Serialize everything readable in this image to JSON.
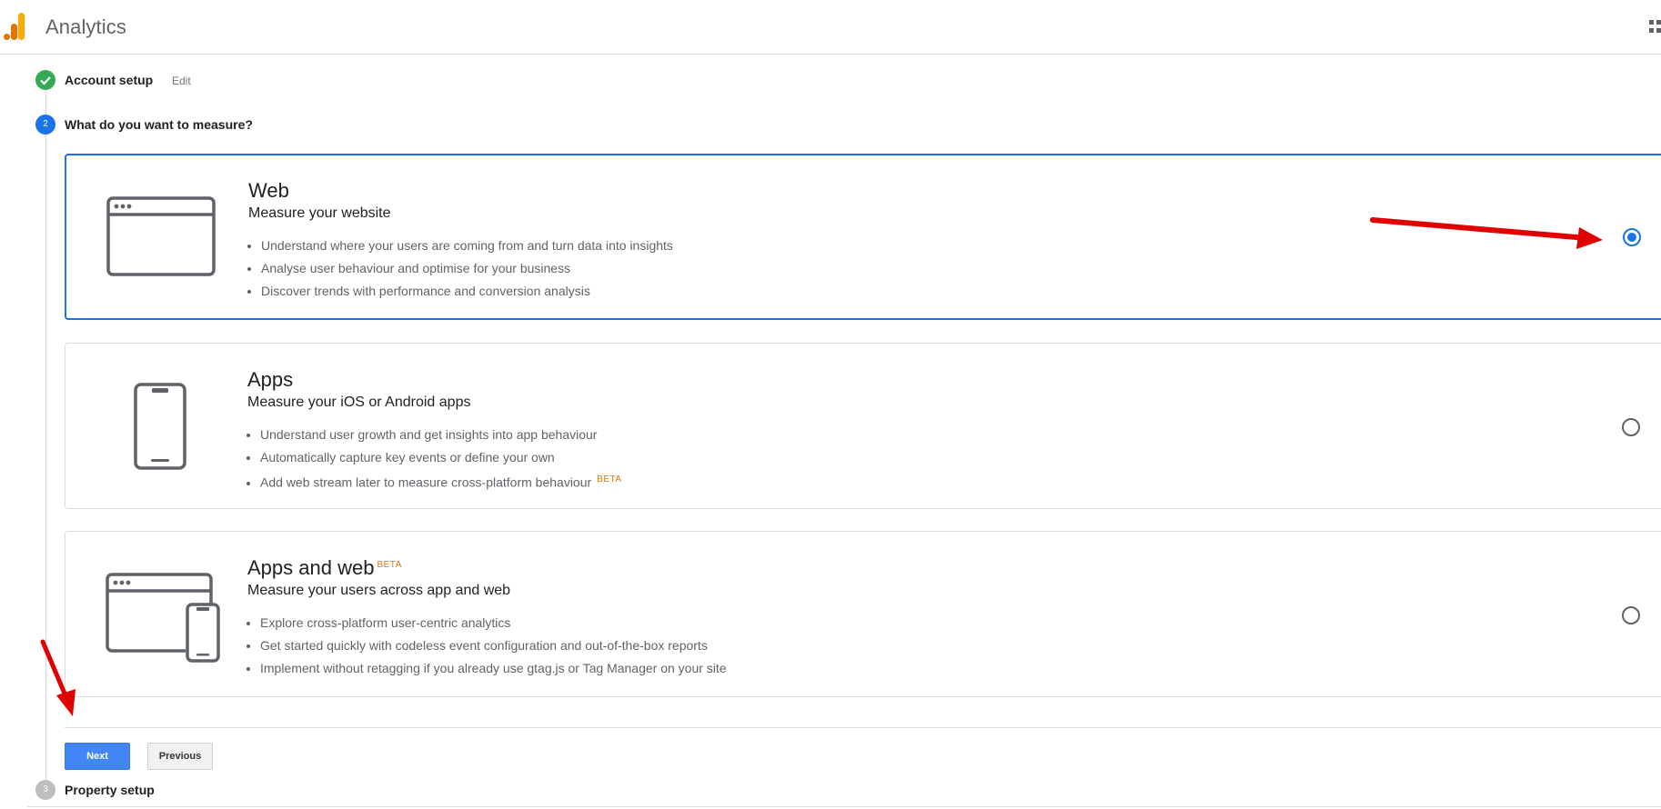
{
  "header": {
    "app_title": "Analytics",
    "logo_icon": "analytics-bar-logo",
    "apps_icon": "apps-grid-icon"
  },
  "steps": {
    "account_setup": {
      "number": "",
      "label": "Account setup",
      "edit_label": "Edit",
      "status": "complete"
    },
    "measure": {
      "number": "2",
      "label": "What do you want to measure?",
      "status": "active"
    },
    "property_setup": {
      "number": "3",
      "label": "Property setup",
      "status": "pending"
    }
  },
  "options": [
    {
      "title": "Web",
      "subtitle": "Measure your website",
      "icon": "browser-window-icon",
      "bullets": [
        "Understand where your users are coming from and turn data into insights",
        "Analyse user behaviour and optimise for your business",
        "Discover trends with performance and conversion analysis"
      ],
      "selected": true
    },
    {
      "title": "Apps",
      "subtitle": "Measure your iOS or Android apps",
      "icon": "smartphone-icon",
      "bullets": [
        "Understand user growth and get insights into app behaviour",
        "Automatically capture key events or define your own",
        "Add web stream later to measure cross-platform behaviour"
      ],
      "bullet_badge": "BETA",
      "selected": false
    },
    {
      "title": "Apps and web",
      "title_badge": "BETA",
      "subtitle": "Measure your users across app and web",
      "icon": "browser-and-phone-icon",
      "bullets": [
        "Explore cross-platform user-centric analytics",
        "Get started quickly with codeless event configuration and out-of-the-box reports",
        "Implement without retagging if you already use gtag.js or Tag Manager on your site"
      ],
      "selected": false
    }
  ],
  "buttons": {
    "next": "Next",
    "previous": "Previous"
  },
  "colors": {
    "accent": "#1a73e8",
    "success": "#34a853",
    "beta": "#e8710a",
    "annotation_arrow": "#e00000",
    "logo_orange": "#f9ab00",
    "logo_dark_orange": "#e37400"
  }
}
